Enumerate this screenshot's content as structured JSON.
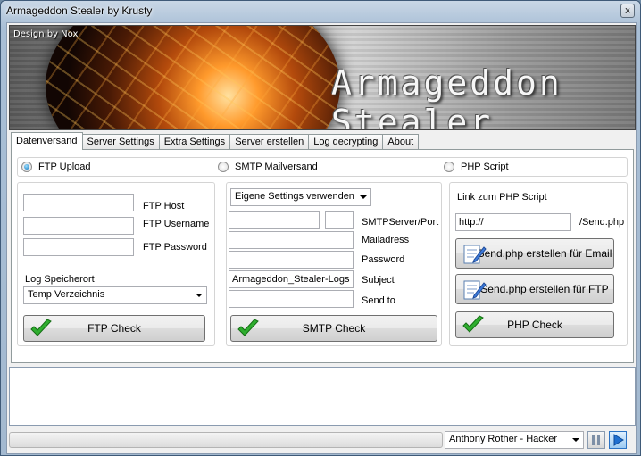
{
  "window": {
    "title": "Armageddon Stealer by Krusty",
    "close_label": "x"
  },
  "banner": {
    "design_credit": "Design by Nox",
    "title": "Armageddon Stealer"
  },
  "tabs": [
    {
      "label": "Datenversand",
      "active": true
    },
    {
      "label": "Server Settings"
    },
    {
      "label": "Extra Settings"
    },
    {
      "label": "Server erstellen"
    },
    {
      "label": "Log decrypting"
    },
    {
      "label": "About"
    }
  ],
  "options": {
    "ftp_upload": "FTP Upload",
    "smtp_mailversand": "SMTP Mailversand",
    "php_script": "PHP Script",
    "selected": "ftp_upload"
  },
  "ftp": {
    "host_label": "FTP Host",
    "username_label": "FTP Username",
    "password_label": "FTP Password",
    "host_value": "",
    "username_value": "",
    "password_value": "",
    "log_location_label": "Log Speicherort",
    "log_location_value": "Temp Verzeichnis",
    "check_button": "FTP Check"
  },
  "smtp": {
    "settings_value": "Eigene Settings verwenden",
    "server_port_label": "SMTPServer/Port",
    "mailaddress_label": "Mailadress",
    "password_label": "Password",
    "subject_label": "Subject",
    "subject_value": "Armageddon_Stealer-Logs",
    "send_to_label": "Send to",
    "check_button": "SMTP Check"
  },
  "php": {
    "link_label": "Link zum PHP Script",
    "url_value": "http://",
    "suffix": "/Send.php",
    "email_button": "Send.php erstellen für Email",
    "ftp_button": "Send.php erstellen für FTP",
    "check_button": "PHP Check"
  },
  "player": {
    "track": "Anthony Rother - Hacker"
  },
  "colors": {
    "accent": "#1a8b1a",
    "title_bar": "#a9bfd6"
  }
}
